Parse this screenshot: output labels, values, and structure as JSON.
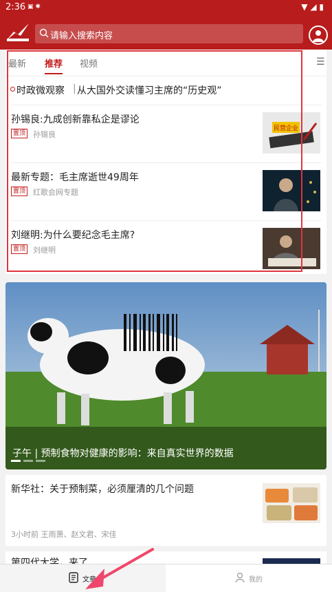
{
  "status_bar": {
    "time": "2:36"
  },
  "header": {
    "search_placeholder": "请输入搜索内容",
    "colors": {
      "brand": "#b81c1c",
      "accent": "#c21c1c",
      "highlight_box": "#e0343e",
      "annotation_arrow": "#f0466b"
    }
  },
  "tabs": [
    {
      "label": "最新",
      "active": false
    },
    {
      "label": "推荐",
      "active": true
    },
    {
      "label": "视频",
      "active": false
    }
  ],
  "topic_line": {
    "part1": "时政微观察",
    "part2": "从大国外交读懂习主席的“历史观”"
  },
  "news": [
    {
      "title": "孙锡良:九成创新靠私企是谬论",
      "tag": "置顶",
      "author": "孙锡良",
      "thumb_text": "民营企业"
    },
    {
      "title": "最新专题：毛主席逝世49周年",
      "tag": "置顶",
      "author": "红歌会网专题"
    },
    {
      "title": "刘继明:为什么要纪念毛主席?",
      "tag": "置顶",
      "author": "刘继明"
    }
  ],
  "hero": {
    "caption": "子午 | 预制食物对健康的影响：来自真实世界的数据"
  },
  "card2": {
    "title": "新华社：关于预制菜，必须厘清的几个问题",
    "meta": "3小时前  王雨萧、赵文君、宋佳"
  },
  "card3": {
    "title": "第四代大学，来了"
  },
  "bottom_nav": [
    {
      "label": "文章",
      "active": true,
      "icon": "article-icon"
    },
    {
      "label": "我的",
      "active": false,
      "icon": "profile-icon"
    }
  ]
}
